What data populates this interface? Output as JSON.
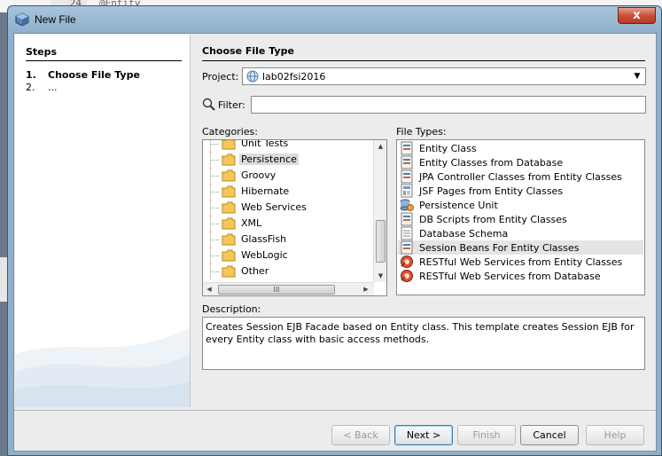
{
  "background_editor": {
    "line_number": "24",
    "code_fragment": "@Entity"
  },
  "window": {
    "title": "New File",
    "close_glyph": "x"
  },
  "steps": {
    "heading": "Steps",
    "items": [
      {
        "num": "1.",
        "label": "Choose File Type"
      },
      {
        "num": "2.",
        "label": "..."
      }
    ]
  },
  "main": {
    "heading": "Choose File Type",
    "project_label": "Project:",
    "project_value": "lab02fsi2016",
    "filter_label": "Filter:",
    "filter_value": "",
    "categories_label": "Categories:",
    "file_types_label": "File Types:",
    "categories": [
      {
        "label": "Unit Tests",
        "selected": false
      },
      {
        "label": "Persistence",
        "selected": true
      },
      {
        "label": "Groovy",
        "selected": false
      },
      {
        "label": "Hibernate",
        "selected": false
      },
      {
        "label": "Web Services",
        "selected": false
      },
      {
        "label": "XML",
        "selected": false
      },
      {
        "label": "GlassFish",
        "selected": false
      },
      {
        "label": "WebLogic",
        "selected": false
      },
      {
        "label": "Other",
        "selected": false
      }
    ],
    "hscroll_grip": "III",
    "file_types": [
      {
        "label": "Entity Class",
        "icon": "entity-class-icon",
        "selected": false
      },
      {
        "label": "Entity Classes from Database",
        "icon": "entity-class-icon",
        "selected": false
      },
      {
        "label": "JPA Controller Classes from Entity Classes",
        "icon": "entity-class-icon",
        "selected": false
      },
      {
        "label": "JSF Pages from Entity Classes",
        "icon": "jsf-page-icon",
        "selected": false
      },
      {
        "label": "Persistence Unit",
        "icon": "persistence-unit-icon",
        "selected": false
      },
      {
        "label": "DB Scripts from Entity Classes",
        "icon": "entity-class-icon",
        "selected": false
      },
      {
        "label": "Database Schema",
        "icon": "database-schema-icon",
        "selected": false
      },
      {
        "label": "Session Beans For Entity Classes",
        "icon": "entity-class-icon",
        "selected": true
      },
      {
        "label": "RESTful Web Services from Entity Classes",
        "icon": "rest-service-icon",
        "selected": false
      },
      {
        "label": "RESTful Web Services from Database",
        "icon": "rest-service-icon",
        "selected": false
      }
    ],
    "description_label": "Description:",
    "description": "Creates Session EJB Facade based on Entity class. This template creates Session EJB for every Entity class with basic access methods."
  },
  "buttons": {
    "back": "< Back",
    "next": "Next >",
    "finish": "Finish",
    "cancel": "Cancel",
    "help": "Help"
  },
  "colors": {
    "title_gradient": "#8fb0cc",
    "close_button": "#c8503a",
    "default_button_border": "#3c7fb1",
    "selection": "#e4e4e4"
  }
}
